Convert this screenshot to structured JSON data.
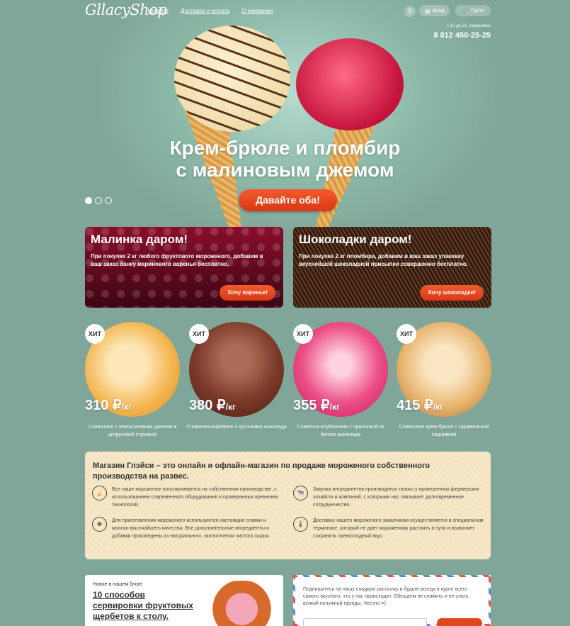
{
  "colors": {
    "background": "#7fa698",
    "accent": "#e0461f",
    "info_bg": "#f3e3bf"
  },
  "header": {
    "logo": "GllacyShop",
    "nav": [
      "Каталог",
      "Доставка и оплата",
      "О компании"
    ],
    "search_icon": "search-icon",
    "login_label": "Вход",
    "cart_label": "Пусто",
    "hours": "с 10 до 20, ежедневно",
    "phone": "8 812 450-25-25"
  },
  "hero": {
    "title_line1": "Крем-брюле и пломбир",
    "title_line2": "с малиновым джемом",
    "button": "Давайте оба!",
    "slide_count": 3,
    "active_slide": 1
  },
  "promos": [
    {
      "title": "Малинка даром!",
      "text": "При покупке 2 кг любого фруктового мороженого, добавим в ваш заказ банку маринового варенья бесплатно.",
      "button": "Хочу варенье!"
    },
    {
      "title": "Шоколадки даром!",
      "text": "При покупке 2 кг пломбира, добавим в ваш заказ упаковку вкуснейшей шоколадной присыпки совершенно бесплатно.",
      "button": "Хочу шоколадки!"
    }
  ],
  "products": [
    {
      "badge": "ХИТ",
      "price": "310 ₽",
      "unit": "/кг",
      "name": "Сливочное с апельсиновым джемом и цитрусовой стружкой",
      "color": "#f3b54f"
    },
    {
      "badge": "ХИТ",
      "price": "380 ₽",
      "unit": "/кг",
      "name": "Сливочно-кофейное с кусочками шоколада",
      "color": "#7c3a2a"
    },
    {
      "badge": "ХИТ",
      "price": "355 ₽",
      "unit": "/кг",
      "name": "Сливочно-клубничное с присыпкой из белого шоколада",
      "color": "#ec4f86"
    },
    {
      "badge": "ХИТ",
      "price": "415 ₽",
      "unit": "/кг",
      "name": "Сливочное крем-брюле с карамельной подливкой",
      "color": "#e7b56f"
    }
  ],
  "info": {
    "title": "Магазин Глэйси – это онлайн и офлайн-магазин по продаже мороженого собственного производства на развес.",
    "features": [
      {
        "icon": "ice-cream-icon",
        "text": "Все наше мороженое изготавливается на собственном производстве, с использованием современного оборудования и проверенных временем технологий."
      },
      {
        "icon": "cow-icon",
        "text": "Закупка ингредиентов производится только у проверенных фермерских хозяйств и компаний, с которыми нас связывает долговременное сотрудничество."
      },
      {
        "icon": "leaf-icon",
        "text": "Для приготовления мороженого используются настоящие сливки и молоко высочайшего качества. Все дополнительные ингредиенты и добавки произведены из натурального, экологически чистого сырья."
      },
      {
        "icon": "thermometer-icon",
        "text": "Доставка нашего мороженого заказчикам осуществляется в специальном термопаке, который не дает мороженому растаять в пути и позволяет сохранить превосходный вкус."
      }
    ]
  },
  "blog": {
    "label": "Новое в нашем блоге",
    "title": "10 способов сервировки фруктовых щербетов к столу."
  },
  "newsletter": {
    "text": "Подпишитесь на нашу сладкую рассылку и будьте всегда в курсе всего самого вкусного, что у нас происходит. Обещаем не спамить и не слать всякой ненужной ерунды. Честно =)"
  }
}
